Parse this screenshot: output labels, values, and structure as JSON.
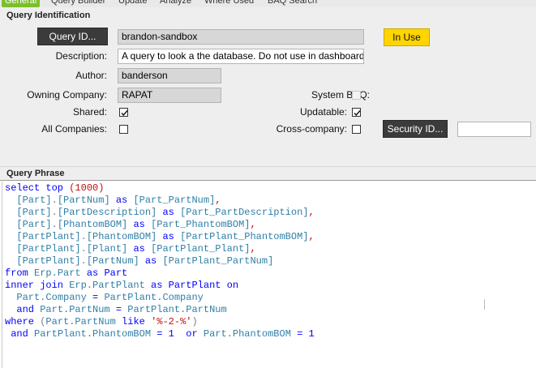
{
  "tabs": [
    {
      "label": "General",
      "active": true
    },
    {
      "label": "Query Builder"
    },
    {
      "label": "Update"
    },
    {
      "label": "Analyze"
    },
    {
      "label": "Where Used"
    },
    {
      "label": "BAQ Search"
    }
  ],
  "identification": {
    "title": "Query Identification",
    "query_id_button": "Query ID...",
    "query_id_value": "brandon-sandbox",
    "in_use_button": "In Use",
    "description_label": "Description:",
    "description_value": "A query to look a the database. Do not use in dashboard",
    "author_label": "Author:",
    "author_value": "banderson",
    "owning_company_label": "Owning Company:",
    "owning_company_value": "RAPAT",
    "system_baq_label": "System BAQ:",
    "system_baq_checked": false,
    "shared_label": "Shared:",
    "shared_checked": true,
    "updatable_label": "Updatable:",
    "updatable_checked": true,
    "all_companies_label": "All Companies:",
    "all_companies_checked": false,
    "cross_company_label": "Cross-company:",
    "cross_company_checked": false,
    "security_id_button": "Security ID...",
    "security_id_value": ""
  },
  "query_phrase": {
    "title": "Query Phrase",
    "lines": [
      {
        "indent": 0,
        "tokens": [
          [
            "select top ",
            "kw"
          ],
          [
            "(1000)",
            "lit"
          ]
        ]
      },
      {
        "indent": 2,
        "tokens": [
          [
            "[Part]",
            "id"
          ],
          [
            ".",
            "pn"
          ],
          [
            "[PartNum]",
            "id"
          ],
          [
            " as ",
            "kw"
          ],
          [
            "[Part_PartNum]",
            "id"
          ],
          [
            ",",
            "lit"
          ]
        ]
      },
      {
        "indent": 2,
        "tokens": [
          [
            "[Part]",
            "id"
          ],
          [
            ".",
            "pn"
          ],
          [
            "[PartDescription]",
            "id"
          ],
          [
            " as ",
            "kw"
          ],
          [
            "[Part_PartDescription]",
            "id"
          ],
          [
            ",",
            "lit"
          ]
        ]
      },
      {
        "indent": 2,
        "tokens": [
          [
            "[Part]",
            "id"
          ],
          [
            ".",
            "pn"
          ],
          [
            "[PhantomBOM]",
            "id"
          ],
          [
            " as ",
            "kw"
          ],
          [
            "[Part_PhantomBOM]",
            "id"
          ],
          [
            ",",
            "lit"
          ]
        ]
      },
      {
        "indent": 2,
        "tokens": [
          [
            "[PartPlant]",
            "id"
          ],
          [
            ".",
            "pn"
          ],
          [
            "[PhantomBOM]",
            "id"
          ],
          [
            " as ",
            "kw"
          ],
          [
            "[PartPlant_PhantomBOM]",
            "id"
          ],
          [
            ",",
            "lit"
          ]
        ]
      },
      {
        "indent": 2,
        "tokens": [
          [
            "[PartPlant]",
            "id"
          ],
          [
            ".",
            "pn"
          ],
          [
            "[Plant]",
            "id"
          ],
          [
            " as ",
            "kw"
          ],
          [
            "[PartPlant_Plant]",
            "id"
          ],
          [
            ",",
            "lit"
          ]
        ]
      },
      {
        "indent": 2,
        "tokens": [
          [
            "[PartPlant]",
            "id"
          ],
          [
            ".",
            "pn"
          ],
          [
            "[PartNum]",
            "id"
          ],
          [
            " as ",
            "kw"
          ],
          [
            "[PartPlant_PartNum]",
            "id"
          ]
        ]
      },
      {
        "indent": 0,
        "tokens": [
          [
            "from ",
            "kw"
          ],
          [
            "Erp.Part",
            "id"
          ],
          [
            " as ",
            "kw"
          ],
          [
            "Part",
            "kw"
          ]
        ]
      },
      {
        "indent": 0,
        "tokens": [
          [
            "inner join ",
            "kw"
          ],
          [
            "Erp.PartPlant",
            "id"
          ],
          [
            " as ",
            "kw"
          ],
          [
            "PartPlant",
            "kw"
          ],
          [
            " on",
            "kw"
          ]
        ]
      },
      {
        "indent": 2,
        "tokens": [
          [
            "Part.Company",
            "id"
          ],
          [
            " = ",
            "kw"
          ],
          [
            "PartPlant.Company",
            "id"
          ]
        ]
      },
      {
        "indent": 2,
        "tokens": [
          [
            "and ",
            "kw"
          ],
          [
            "Part.PartNum",
            "id"
          ],
          [
            " = ",
            "kw"
          ],
          [
            "PartPlant.PartNum",
            "id"
          ]
        ]
      },
      {
        "indent": 0,
        "tokens": [
          [
            "where ",
            "kw"
          ],
          [
            "(",
            "pn"
          ],
          [
            "Part.PartNum",
            "id"
          ],
          [
            " like ",
            "kw"
          ],
          [
            "'%-2-%'",
            "lit"
          ],
          [
            ")",
            "pn"
          ]
        ]
      },
      {
        "indent": 1,
        "tokens": [
          [
            "and ",
            "kw"
          ],
          [
            "PartPlant.PhantomBOM",
            "id"
          ],
          [
            " = ",
            "kw"
          ],
          [
            "1",
            "kw"
          ],
          [
            "  or ",
            "kw"
          ],
          [
            "Part.PhantomBOM",
            "id"
          ],
          [
            " = ",
            "kw"
          ],
          [
            "1",
            "kw"
          ]
        ]
      }
    ]
  },
  "colors": {
    "active_tab": "#7cbf2b",
    "dark_button": "#3b3b3b",
    "in_use_button": "#ffd400",
    "sql_keyword": "#0000ff",
    "sql_identifier": "#2f7fa6",
    "sql_literal": "#c01010"
  }
}
